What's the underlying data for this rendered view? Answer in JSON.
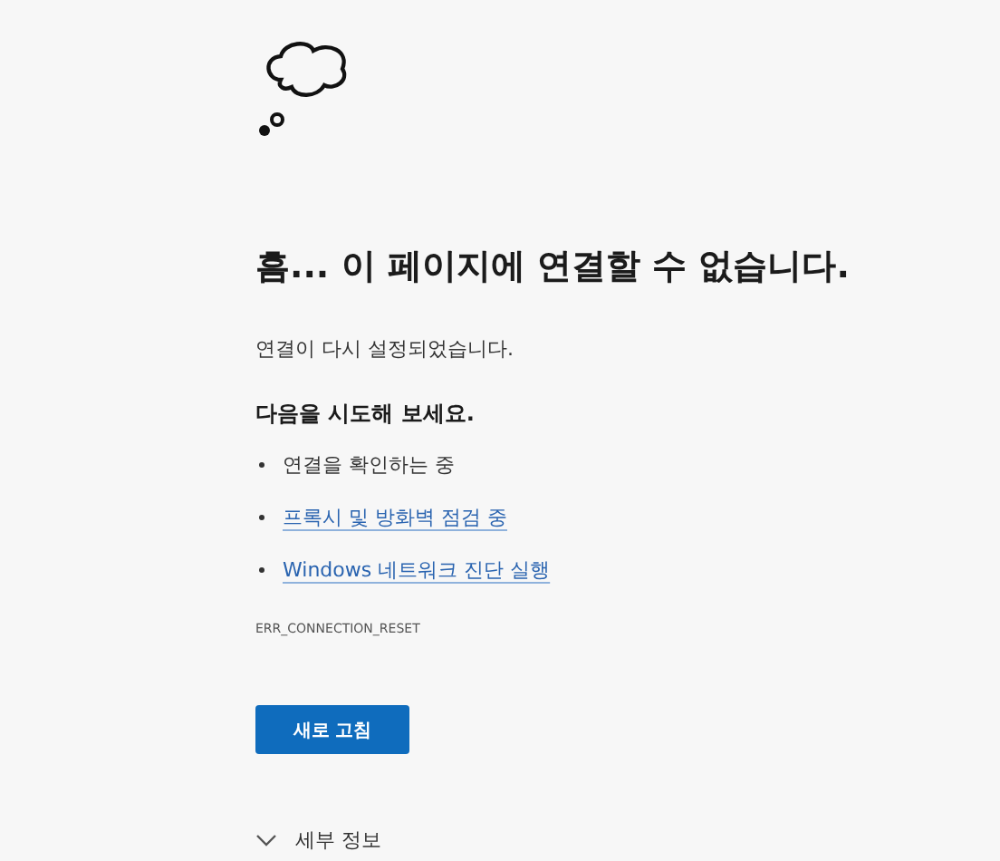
{
  "heading": "흠... 이 페이지에 연결할 수 없습니다.",
  "message": "연결이 다시 설정되었습니다.",
  "suggestions_title": "다음을 시도해 보세요.",
  "suggestions": [
    {
      "kind": "text",
      "label": "연결을 확인하는 중"
    },
    {
      "kind": "link",
      "label": "프록시 및 방화벽 점검 중"
    },
    {
      "kind": "link",
      "label": "Windows 네트워크 진단 실행"
    }
  ],
  "error_code": "ERR_CONNECTION_RESET",
  "refresh_button": "새로 고침",
  "details": {
    "label": "세부 정보",
    "expanded": false
  }
}
